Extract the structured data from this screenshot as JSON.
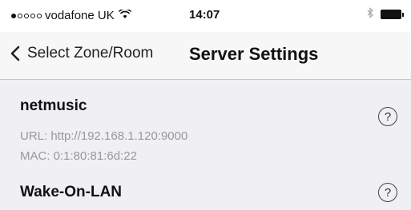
{
  "status_bar": {
    "carrier": "vodafone UK",
    "time": "14:07",
    "signal_filled": 1,
    "signal_total": 5
  },
  "nav": {
    "back_label": "Select Zone/Room",
    "title": "Server Settings"
  },
  "server": {
    "name": "netmusic",
    "url_line": "URL: http://192.168.1.120:9000",
    "mac_line": "MAC: 0:1:80:81:6d:22",
    "help_symbol": "?"
  },
  "wake_on_lan": {
    "label": "Wake-On-LAN",
    "help_symbol": "?"
  },
  "icons": {
    "back": "chevron-left-icon",
    "help": "question-circle-icon",
    "wifi": "wifi-icon",
    "bluetooth": "bluetooth-icon",
    "battery": "battery-icon"
  }
}
